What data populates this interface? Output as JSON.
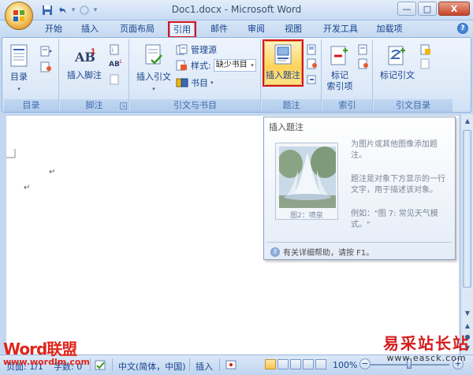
{
  "window": {
    "title": "Doc1.docx - Microsoft Word",
    "controls": {
      "minimize": "—",
      "restore": "□",
      "close": "X"
    }
  },
  "quick_access": {
    "save_icon": "save-icon",
    "undo_icon": "undo-icon",
    "redo_icon": "redo-icon"
  },
  "tabs": [
    {
      "label": "开始"
    },
    {
      "label": "插入"
    },
    {
      "label": "页面布局"
    },
    {
      "label": "引用",
      "active": true
    },
    {
      "label": "邮件"
    },
    {
      "label": "审阅"
    },
    {
      "label": "视图"
    },
    {
      "label": "开发工具"
    },
    {
      "label": "加载项"
    }
  ],
  "ribbon": {
    "toc": {
      "label": "目录",
      "group": "目录"
    },
    "footnote": {
      "label": "插入脚注",
      "group": "脚注"
    },
    "citation": {
      "label": "插入引文",
      "manage_sources": "管理源",
      "style_label": "样式:",
      "style_value": "缺少书目",
      "bibliography": "书目",
      "group": "引文与书目"
    },
    "caption": {
      "label": "插入题注",
      "group": "题注"
    },
    "index": {
      "label_line1": "标记",
      "label_line2": "索引项",
      "group": "索引"
    },
    "toa": {
      "label": "标记引文",
      "group": "引文目录"
    }
  },
  "tooltip": {
    "title": "插入题注",
    "image_caption": "图2：喷泉",
    "line1": "为图片或其他图像添加题注。",
    "line2": "题注是对象下方显示的一行文字，用于描述该对象。",
    "line3": "例如：\"图 7: 常见天气模式。\"",
    "help": "有关详细帮助，请按 F1。"
  },
  "status_bar": {
    "page": "页面: 1/1",
    "words": "字数: 0",
    "language": "中文(简体，中国)",
    "mode": "插入",
    "zoom": "100%",
    "zoom_minus": "−",
    "zoom_plus": "+"
  },
  "watermarks": {
    "left_brand_1": "Word",
    "left_brand_2": "联盟",
    "left_url": "www.wordlm.com",
    "right_cn": "易采站长站",
    "right_url": "www.easck.com"
  },
  "colors": {
    "accent": "#15428b",
    "highlight": "#d8161c",
    "ribbon_bg": "#dde9f8"
  }
}
